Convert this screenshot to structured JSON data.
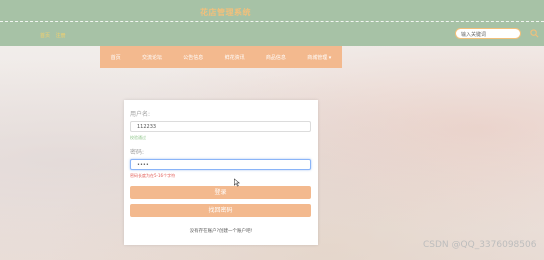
{
  "header": {
    "site_title": "花店管理系统",
    "links": [
      "首页",
      "注册"
    ],
    "search_placeholder": "输入关键词"
  },
  "nav": {
    "items": [
      "首页",
      "交流论坛",
      "公告信息",
      "鲜花资讯",
      "商品信息",
      "商城管理 ▾"
    ]
  },
  "login": {
    "username_label": "用户名:",
    "username_value": "112233",
    "username_hint": "校验通过",
    "password_label": "密码:",
    "password_value": "••••",
    "password_error": "密码长度为在5-16个字符",
    "login_button": "登录",
    "forgot_button": "找回密码",
    "register_link": "没有存在账户?创建一个账户吧!"
  },
  "watermark": "CSDN @QQ_3376098506",
  "colors": {
    "header_bg": "#a7c2a6",
    "title": "#f2c07b",
    "accent": "#f3b98e",
    "error": "#e25a55",
    "success": "#8fc58a"
  }
}
